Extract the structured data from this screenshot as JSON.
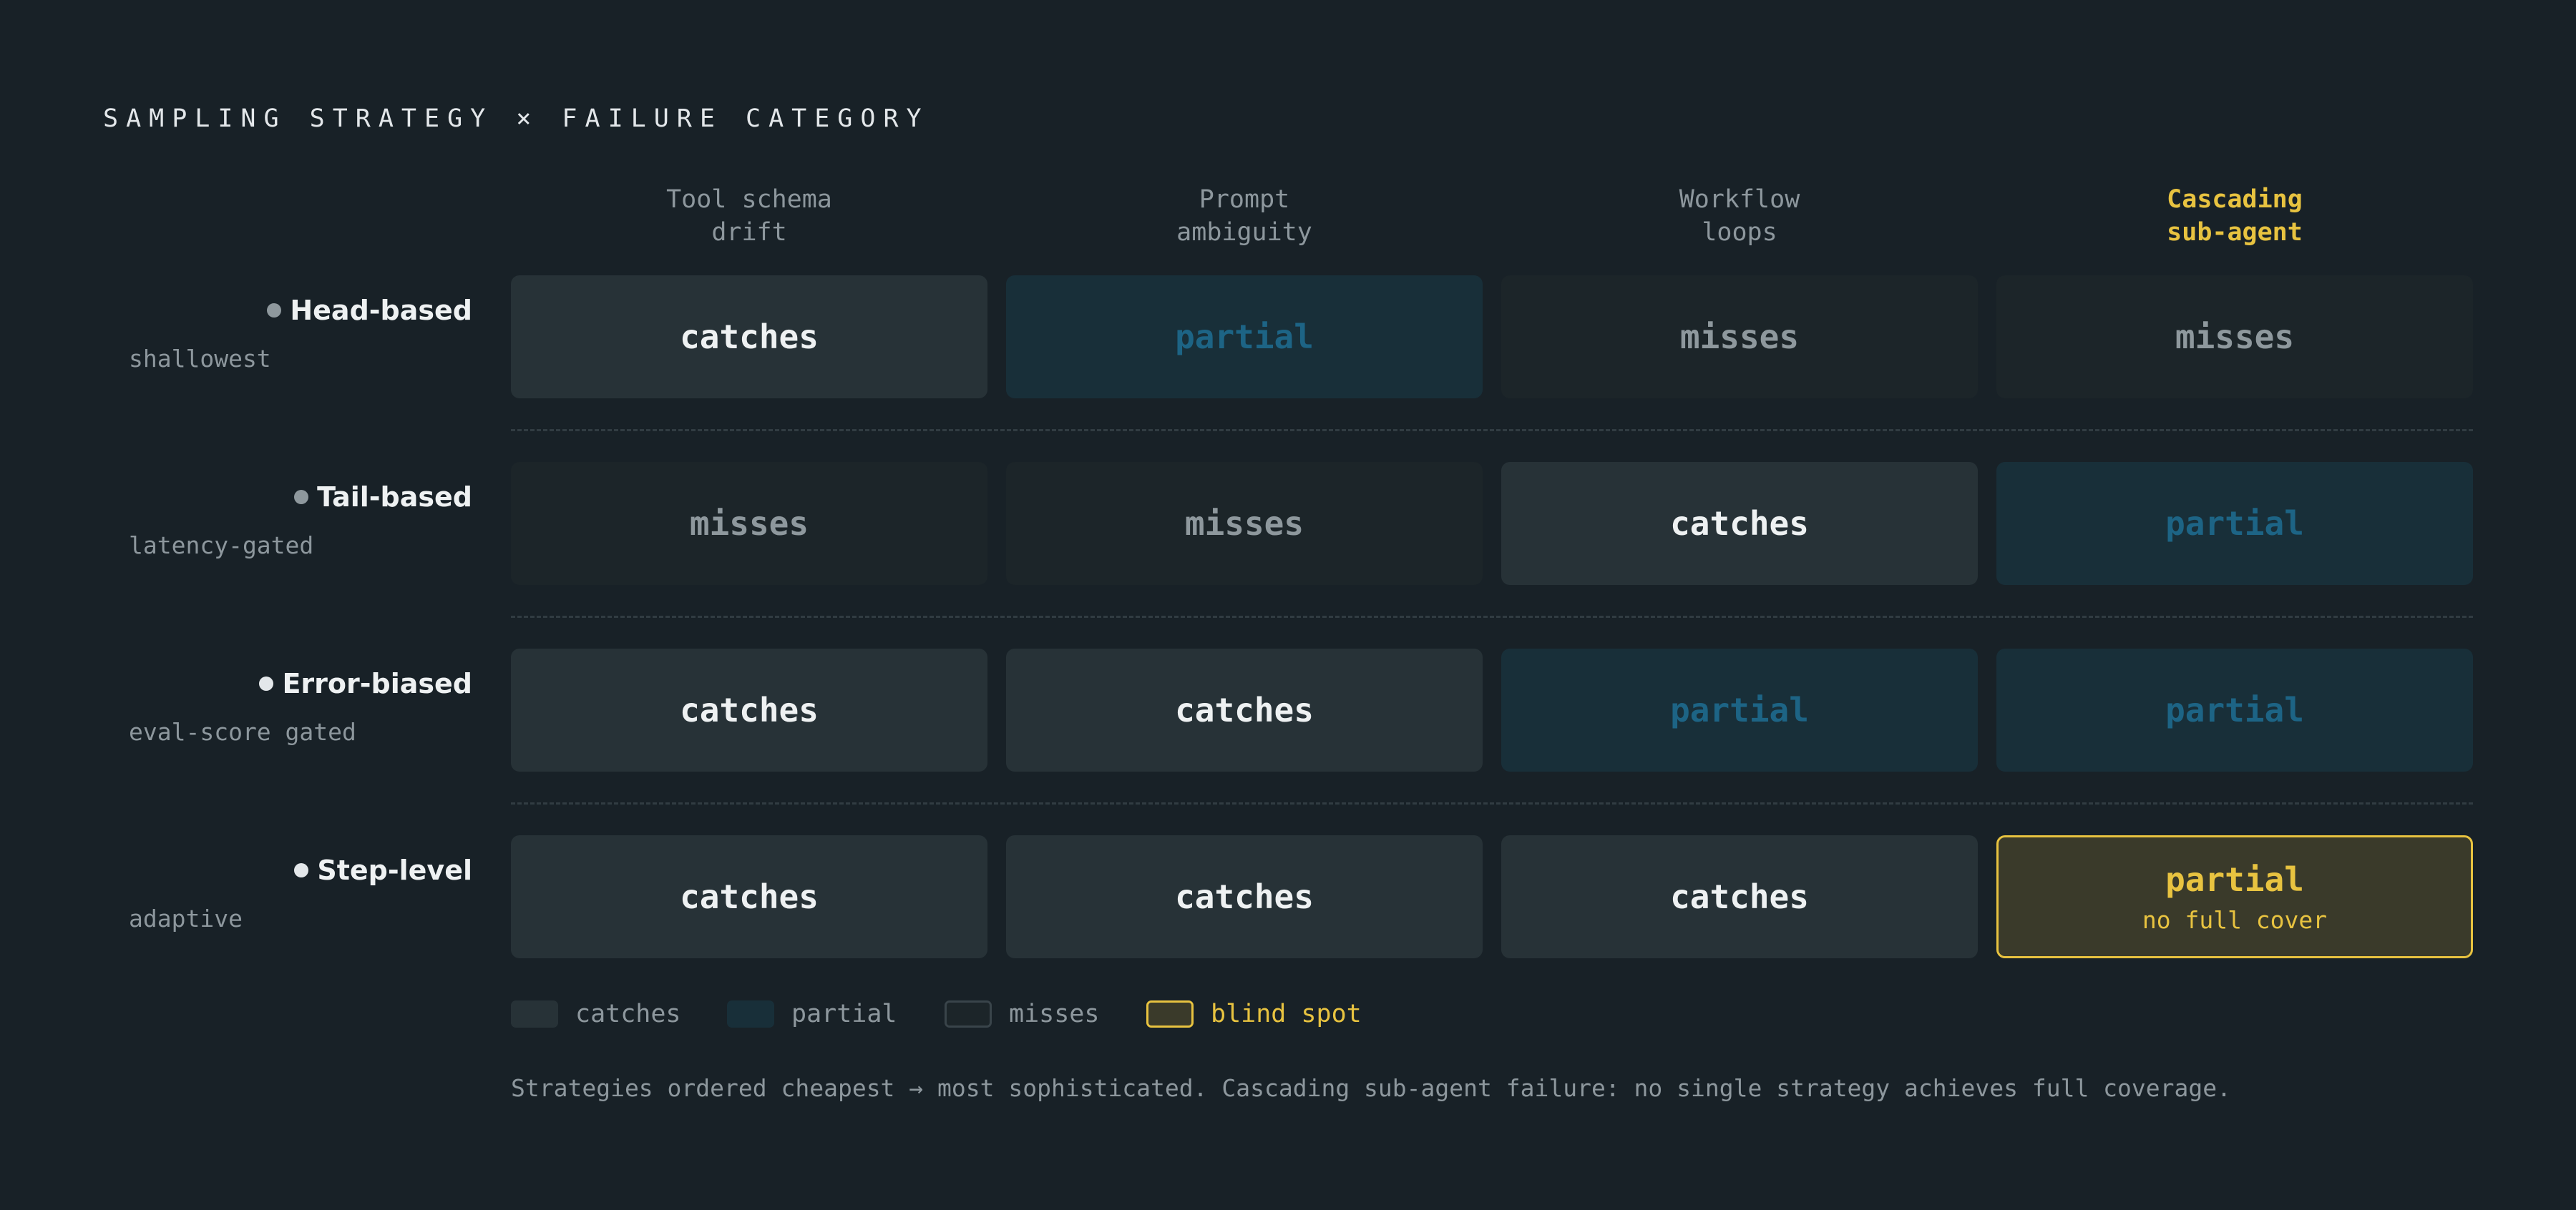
{
  "title": "SAMPLING STRATEGY × FAILURE CATEGORY",
  "columns": [
    {
      "label": "Tool schema\ndrift",
      "highlight": false
    },
    {
      "label": "Prompt\nambiguity",
      "highlight": false
    },
    {
      "label": "Workflow\nloops",
      "highlight": false
    },
    {
      "label": "Cascading\nsub-agent",
      "highlight": true
    }
  ],
  "rows": [
    {
      "name": "Head-based",
      "sub": "shallowest",
      "dot_color": "#8e989d",
      "cells": [
        {
          "status": "catches",
          "label": "catches"
        },
        {
          "status": "partial",
          "label": "partial"
        },
        {
          "status": "misses",
          "label": "misses"
        },
        {
          "status": "misses",
          "label": "misses"
        }
      ]
    },
    {
      "name": "Tail-based",
      "sub": "latency-gated",
      "dot_color": "#8e989d",
      "cells": [
        {
          "status": "misses",
          "label": "misses"
        },
        {
          "status": "misses",
          "label": "misses"
        },
        {
          "status": "catches",
          "label": "catches"
        },
        {
          "status": "partial",
          "label": "partial"
        }
      ]
    },
    {
      "name": "Error-biased",
      "sub": "eval-score gated",
      "dot_color": "#e3e7ea",
      "cells": [
        {
          "status": "catches",
          "label": "catches"
        },
        {
          "status": "catches",
          "label": "catches"
        },
        {
          "status": "partial",
          "label": "partial"
        },
        {
          "status": "partial",
          "label": "partial"
        }
      ]
    },
    {
      "name": "Step-level",
      "sub": "adaptive",
      "dot_color": "#e3e7ea",
      "cells": [
        {
          "status": "catches",
          "label": "catches"
        },
        {
          "status": "catches",
          "label": "catches"
        },
        {
          "status": "catches",
          "label": "catches"
        },
        {
          "status": "blind",
          "label": "partial",
          "sub": "no full cover"
        }
      ]
    }
  ],
  "legend": [
    {
      "status": "catches",
      "label": "catches"
    },
    {
      "status": "partial",
      "label": "partial"
    },
    {
      "status": "misses",
      "label": "misses"
    },
    {
      "status": "blind",
      "label": "blind spot"
    }
  ],
  "footnote": "Strategies ordered cheapest → most sophisticated. Cascading sub-agent failure: no single strategy achieves full coverage.",
  "colors": {
    "background": "#182127",
    "catches": "#273237",
    "partial": "#182f39",
    "partial_text": "#1d6485",
    "misses": "#1c2529",
    "blind_spot": "#e8c340"
  }
}
